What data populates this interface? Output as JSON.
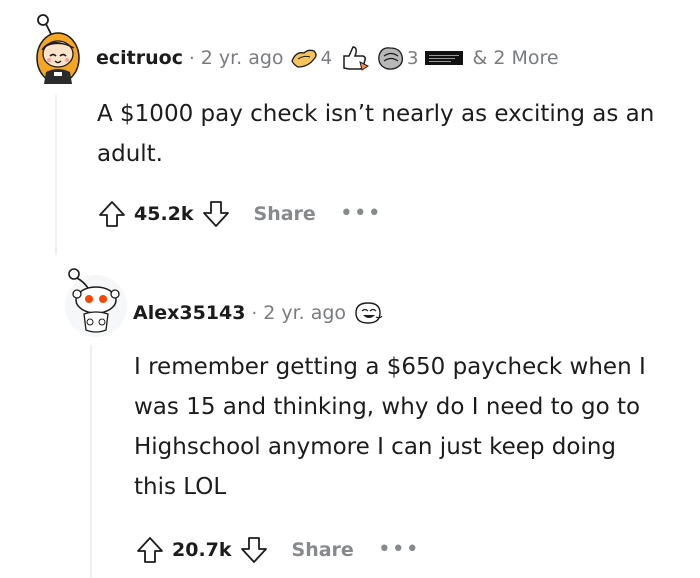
{
  "comments": [
    {
      "username": "ecitruoc",
      "age": "2 yr. ago",
      "awards": [
        {
          "icon": "hands-award-icon",
          "count": "4"
        },
        {
          "icon": "thumbs-up-award-icon",
          "count": ""
        },
        {
          "icon": "hug-award-icon",
          "count": "3"
        },
        {
          "icon": "wholesome-sign-award-icon",
          "count": ""
        }
      ],
      "more_awards": "& 2 More",
      "body": "A $1000 pay check isn’t nearly as exciting as an adult.",
      "score": "45.2k",
      "share_label": "Share",
      "more_label": "•••"
    },
    {
      "username": "Alex35143",
      "age": "2 yr. ago",
      "awards": [
        {
          "icon": "laughing-face-award-icon",
          "count": ""
        }
      ],
      "body": "I remember getting a $650 paycheck when I was 15 and thinking, why do I need to go to Highschool anymore I can just keep doing this LOL",
      "score": "20.7k",
      "share_label": "Share",
      "more_label": "•••"
    }
  ],
  "colors": {
    "text": "#1c1c1c",
    "meta": "#787c7e",
    "action_gray": "#878a8c",
    "thread_line": "#edeff1",
    "avatar1_hair": "#f5a623",
    "snoo_red": "#ff4500"
  }
}
